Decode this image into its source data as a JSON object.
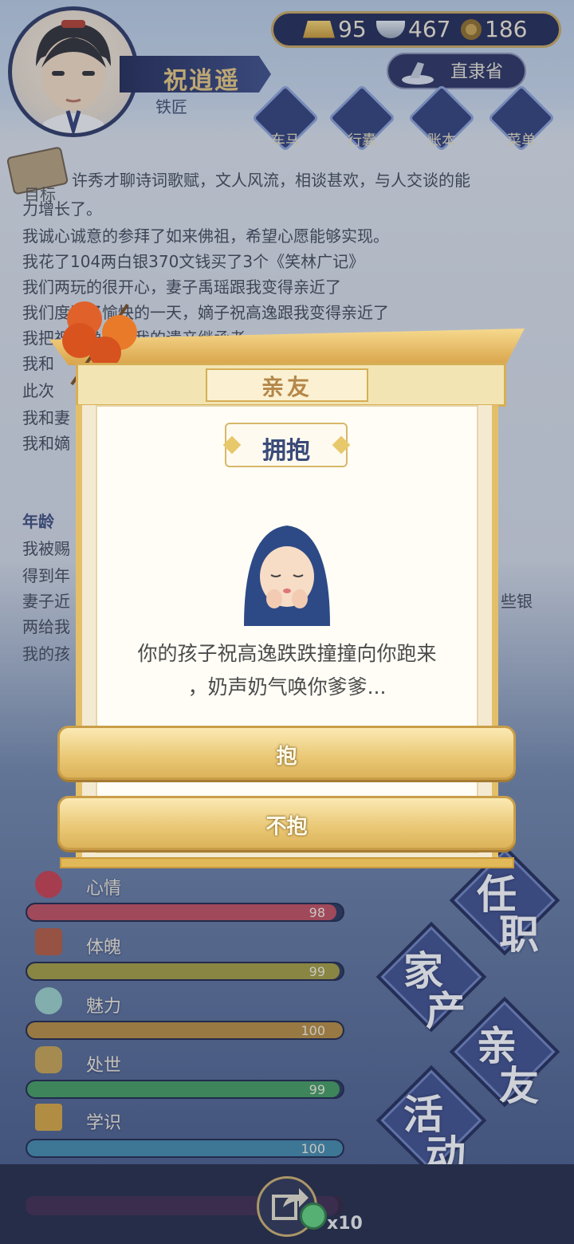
{
  "resources": {
    "gold": "95",
    "silver": "467",
    "copper": "186"
  },
  "player": {
    "name": "祝逍遥",
    "job": "铁匠"
  },
  "region": "直隶省",
  "top_menu": [
    {
      "label": "车马"
    },
    {
      "label": "行囊"
    },
    {
      "label": "账本"
    },
    {
      "label": "菜单"
    }
  ],
  "goal_label": "目标",
  "log": {
    "lines": [
      "力增长了。",
      "我诚心诚意的参拜了如来佛祖，希望心愿能够实现。",
      "我花了104两白银370文钱买了3个《笑林广记》",
      "我们两玩的很开心，妻子禹瑶跟我变得亲近了",
      "我们度过了愉快的一天，嫡子祝高逸跟我变得亲近了",
      "我把祝高逸作为我的遗产继承者",
      "我和",
      "此次",
      "我和妻",
      "我和嫡"
    ],
    "line_partial": "许秀才聊诗词歌赋，文人风流，相谈甚欢，与人交谈的能",
    "age_label": "年龄",
    "lines2": [
      "我被赐",
      "得到年",
      "妻子近",
      "两给我",
      "我的孩"
    ],
    "right_fragment": "些银"
  },
  "modal": {
    "category": "亲友",
    "event_title": "拥抱",
    "description_line1": "你的孩子祝高逸跌跌撞撞向你跑来",
    "description_line2": "，奶声奶气唤你爹爹...",
    "options": [
      {
        "label": "抱"
      },
      {
        "label": "不抱"
      }
    ]
  },
  "stats": [
    {
      "label": "心情",
      "value": "98",
      "fill": 0.98,
      "color": "#c24a5a"
    },
    {
      "label": "体魄",
      "value": "99",
      "fill": 0.99,
      "color": "#a39a3a"
    },
    {
      "label": "魅力",
      "value": "100",
      "fill": 1.0,
      "color": "#b78a3a"
    },
    {
      "label": "处世",
      "value": "99",
      "fill": 0.99,
      "color": "#3f9a5a"
    },
    {
      "label": "学识",
      "value": "100",
      "fill": 1.0,
      "color": "#3f86a8"
    },
    {
      "label": "德行",
      "value": "",
      "fill": 0.98,
      "color": "#7a3a7a"
    }
  ],
  "big_nav": {
    "ren_zhi": {
      "c1": "任",
      "c2": "职"
    },
    "jia_chan": {
      "c1": "家",
      "c2": "产"
    },
    "qin_you": {
      "c1": "亲",
      "c2": "友"
    },
    "huo_dong": {
      "c1": "活",
      "c2": "动"
    }
  },
  "bottom": {
    "multiplier": "x10"
  }
}
